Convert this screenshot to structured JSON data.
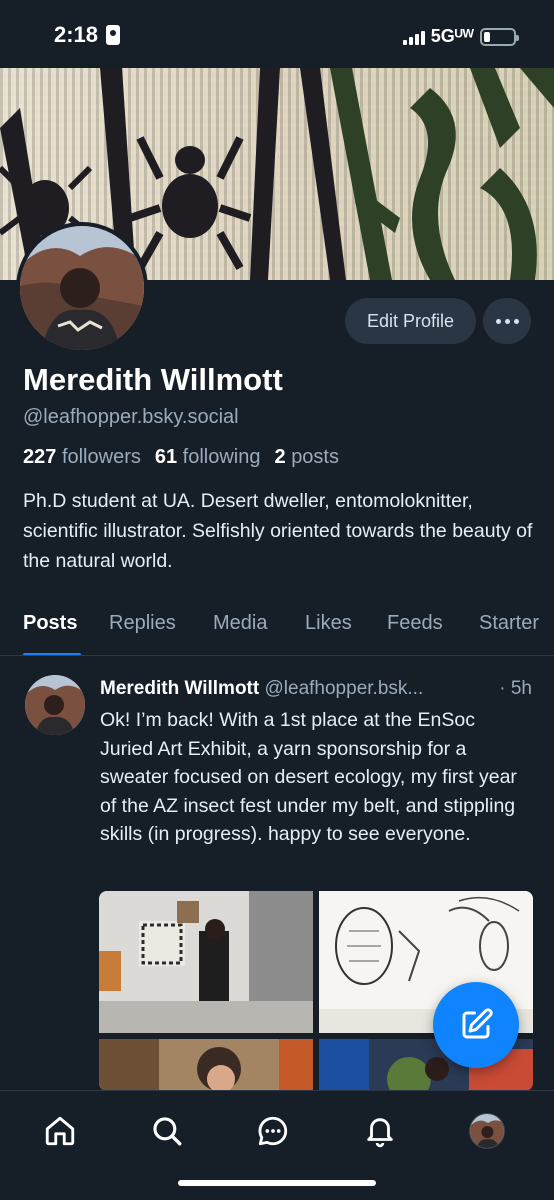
{
  "status_bar": {
    "time": "2:18",
    "network": "5Gᵁᵂ",
    "battery_level": 0.2
  },
  "profile": {
    "edit_label": "Edit Profile",
    "more_icon": "ellipsis-icon",
    "display_name": "Meredith Willmott",
    "handle": "@leafhopper.bsky.social",
    "followers_count": "227",
    "followers_label": "followers",
    "following_count": "61",
    "following_label": "following",
    "posts_count": "2",
    "posts_label": "posts",
    "bio": "Ph.D student at UA. Desert dweller, entomoloknitter, scientific illustrator. Selfishly oriented towards the beauty of the natural world."
  },
  "tabs": [
    {
      "label": "Posts",
      "active": true
    },
    {
      "label": "Replies",
      "active": false
    },
    {
      "label": "Media",
      "active": false
    },
    {
      "label": "Likes",
      "active": false
    },
    {
      "label": "Feeds",
      "active": false
    },
    {
      "label": "Starter",
      "active": false
    }
  ],
  "post": {
    "author": "Meredith Willmott",
    "handle": "@leafhopper.bsk...",
    "time": "· 5h",
    "text": "Ok! I’m back! With a 1st place at the EnSoc Juried Art Exhibit, a yarn sponsorship for a sweater focused on desert ecology, my first year of the AZ insect fest under my belt, and stippling skills (in progress). happy to see everyone."
  },
  "nav": {
    "items": [
      "home-icon",
      "search-icon",
      "chat-icon",
      "bell-icon",
      "profile-avatar"
    ]
  },
  "colors": {
    "background": "#161e27",
    "accent": "#1083fe",
    "muted_text": "#9aabbc"
  }
}
